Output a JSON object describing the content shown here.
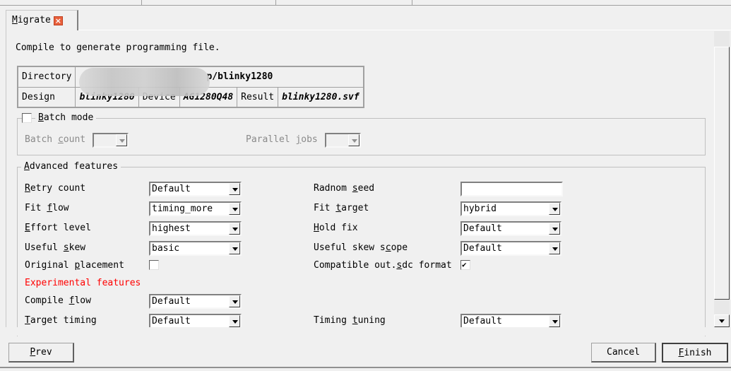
{
  "tab": {
    "label": "Migrate",
    "mnemonic": 0,
    "close_icon": "close-icon"
  },
  "description": "Compile to generate programming file.",
  "info_table": {
    "directory_label": "Directory",
    "directory_value": "p/blinky1280",
    "design_label": "Design",
    "design_value": "blinky1280",
    "device_label": "Device",
    "device_value": "AG1280Q48",
    "result_label": "Result",
    "result_value": "blinky1280.svf"
  },
  "batch": {
    "mode_label": "Batch mode",
    "mode_mnemonic": 0,
    "mode_checked": false,
    "count_label": "Batch count",
    "count_mnemonic": 6,
    "count_value": "",
    "jobs_label": "Parallel jobs",
    "jobs_mnemonic": 9,
    "jobs_value": ""
  },
  "advanced": {
    "title": "Advanced features",
    "title_mnemonic": 0,
    "left": [
      {
        "label": "Retry count",
        "mnemonic": 0,
        "type": "combo",
        "value": "Default"
      },
      {
        "label": "Fit flow",
        "mnemonic": 4,
        "type": "combo",
        "value": "timing_more"
      },
      {
        "label": "Effort level",
        "mnemonic": 0,
        "type": "combo",
        "value": "highest"
      },
      {
        "label": "Useful skew",
        "mnemonic": 7,
        "type": "combo",
        "value": "basic"
      },
      {
        "label": "Original placement",
        "mnemonic": 9,
        "type": "checkbox",
        "checked": false
      }
    ],
    "right": [
      {
        "label": "Radnom seed",
        "mnemonic": 7,
        "type": "text",
        "value": ""
      },
      {
        "label": "Fit target",
        "mnemonic": 4,
        "type": "combo",
        "value": "hybrid"
      },
      {
        "label": "Hold fix",
        "mnemonic": 0,
        "type": "combo",
        "value": "Default"
      },
      {
        "label": "Useful skew scope",
        "mnemonic": 13,
        "type": "combo",
        "value": "Default"
      },
      {
        "label": "Compatible out.sdc format",
        "mnemonic": 15,
        "type": "checkbox",
        "checked": true
      }
    ],
    "experimental_title": "Experimental features",
    "experimental_color": "#ff0000",
    "experimental_left": [
      {
        "label": "Compile flow",
        "mnemonic": 8,
        "type": "combo",
        "value": "Default"
      },
      {
        "label": "Target timing",
        "mnemonic": 0,
        "type": "combo",
        "value": "Default"
      }
    ],
    "experimental_right": [
      {
        "label": "Timing tuning",
        "mnemonic": 7,
        "type": "combo",
        "value": "Default"
      }
    ]
  },
  "buttons": {
    "prev": {
      "label": "Prev",
      "mnemonic": 0
    },
    "cancel": {
      "label": "Cancel",
      "mnemonic": -1
    },
    "finish": {
      "label": "Finish",
      "mnemonic": 0
    }
  }
}
